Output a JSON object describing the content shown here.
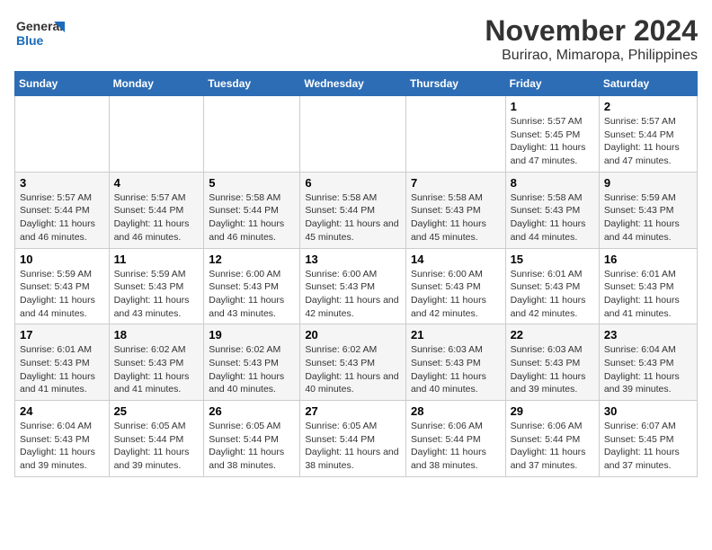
{
  "logo": {
    "line1": "General",
    "line2": "Blue"
  },
  "title": "November 2024",
  "subtitle": "Burirao, Mimaropa, Philippines",
  "days_of_week": [
    "Sunday",
    "Monday",
    "Tuesday",
    "Wednesday",
    "Thursday",
    "Friday",
    "Saturday"
  ],
  "weeks": [
    [
      {
        "day": "",
        "info": ""
      },
      {
        "day": "",
        "info": ""
      },
      {
        "day": "",
        "info": ""
      },
      {
        "day": "",
        "info": ""
      },
      {
        "day": "",
        "info": ""
      },
      {
        "day": "1",
        "info": "Sunrise: 5:57 AM\nSunset: 5:45 PM\nDaylight: 11 hours and 47 minutes."
      },
      {
        "day": "2",
        "info": "Sunrise: 5:57 AM\nSunset: 5:44 PM\nDaylight: 11 hours and 47 minutes."
      }
    ],
    [
      {
        "day": "3",
        "info": "Sunrise: 5:57 AM\nSunset: 5:44 PM\nDaylight: 11 hours and 46 minutes."
      },
      {
        "day": "4",
        "info": "Sunrise: 5:57 AM\nSunset: 5:44 PM\nDaylight: 11 hours and 46 minutes."
      },
      {
        "day": "5",
        "info": "Sunrise: 5:58 AM\nSunset: 5:44 PM\nDaylight: 11 hours and 46 minutes."
      },
      {
        "day": "6",
        "info": "Sunrise: 5:58 AM\nSunset: 5:44 PM\nDaylight: 11 hours and 45 minutes."
      },
      {
        "day": "7",
        "info": "Sunrise: 5:58 AM\nSunset: 5:43 PM\nDaylight: 11 hours and 45 minutes."
      },
      {
        "day": "8",
        "info": "Sunrise: 5:58 AM\nSunset: 5:43 PM\nDaylight: 11 hours and 44 minutes."
      },
      {
        "day": "9",
        "info": "Sunrise: 5:59 AM\nSunset: 5:43 PM\nDaylight: 11 hours and 44 minutes."
      }
    ],
    [
      {
        "day": "10",
        "info": "Sunrise: 5:59 AM\nSunset: 5:43 PM\nDaylight: 11 hours and 44 minutes."
      },
      {
        "day": "11",
        "info": "Sunrise: 5:59 AM\nSunset: 5:43 PM\nDaylight: 11 hours and 43 minutes."
      },
      {
        "day": "12",
        "info": "Sunrise: 6:00 AM\nSunset: 5:43 PM\nDaylight: 11 hours and 43 minutes."
      },
      {
        "day": "13",
        "info": "Sunrise: 6:00 AM\nSunset: 5:43 PM\nDaylight: 11 hours and 42 minutes."
      },
      {
        "day": "14",
        "info": "Sunrise: 6:00 AM\nSunset: 5:43 PM\nDaylight: 11 hours and 42 minutes."
      },
      {
        "day": "15",
        "info": "Sunrise: 6:01 AM\nSunset: 5:43 PM\nDaylight: 11 hours and 42 minutes."
      },
      {
        "day": "16",
        "info": "Sunrise: 6:01 AM\nSunset: 5:43 PM\nDaylight: 11 hours and 41 minutes."
      }
    ],
    [
      {
        "day": "17",
        "info": "Sunrise: 6:01 AM\nSunset: 5:43 PM\nDaylight: 11 hours and 41 minutes."
      },
      {
        "day": "18",
        "info": "Sunrise: 6:02 AM\nSunset: 5:43 PM\nDaylight: 11 hours and 41 minutes."
      },
      {
        "day": "19",
        "info": "Sunrise: 6:02 AM\nSunset: 5:43 PM\nDaylight: 11 hours and 40 minutes."
      },
      {
        "day": "20",
        "info": "Sunrise: 6:02 AM\nSunset: 5:43 PM\nDaylight: 11 hours and 40 minutes."
      },
      {
        "day": "21",
        "info": "Sunrise: 6:03 AM\nSunset: 5:43 PM\nDaylight: 11 hours and 40 minutes."
      },
      {
        "day": "22",
        "info": "Sunrise: 6:03 AM\nSunset: 5:43 PM\nDaylight: 11 hours and 39 minutes."
      },
      {
        "day": "23",
        "info": "Sunrise: 6:04 AM\nSunset: 5:43 PM\nDaylight: 11 hours and 39 minutes."
      }
    ],
    [
      {
        "day": "24",
        "info": "Sunrise: 6:04 AM\nSunset: 5:43 PM\nDaylight: 11 hours and 39 minutes."
      },
      {
        "day": "25",
        "info": "Sunrise: 6:05 AM\nSunset: 5:44 PM\nDaylight: 11 hours and 39 minutes."
      },
      {
        "day": "26",
        "info": "Sunrise: 6:05 AM\nSunset: 5:44 PM\nDaylight: 11 hours and 38 minutes."
      },
      {
        "day": "27",
        "info": "Sunrise: 6:05 AM\nSunset: 5:44 PM\nDaylight: 11 hours and 38 minutes."
      },
      {
        "day": "28",
        "info": "Sunrise: 6:06 AM\nSunset: 5:44 PM\nDaylight: 11 hours and 38 minutes."
      },
      {
        "day": "29",
        "info": "Sunrise: 6:06 AM\nSunset: 5:44 PM\nDaylight: 11 hours and 37 minutes."
      },
      {
        "day": "30",
        "info": "Sunrise: 6:07 AM\nSunset: 5:45 PM\nDaylight: 11 hours and 37 minutes."
      }
    ]
  ]
}
